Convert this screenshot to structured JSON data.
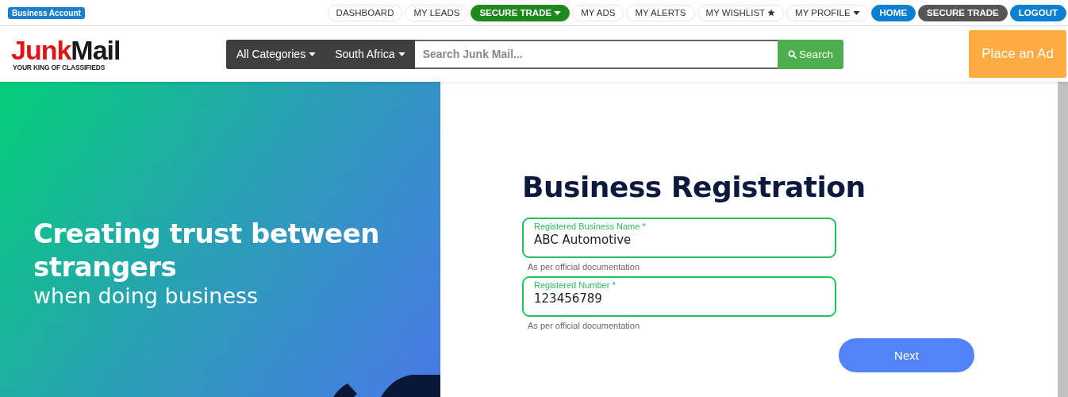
{
  "account_badge": "Business Account",
  "top_nav": [
    {
      "label": "DASHBOARD",
      "kind": "pill"
    },
    {
      "label": "MY LEADS",
      "kind": "pill"
    },
    {
      "label": "SECURE TRADE",
      "kind": "green-caret"
    },
    {
      "label": "MY ADS",
      "kind": "pill"
    },
    {
      "label": "MY ALERTS",
      "kind": "pill"
    },
    {
      "label": "MY WISHLIST",
      "kind": "pill-star"
    },
    {
      "label": "MY PROFILE",
      "kind": "pill-caret"
    },
    {
      "label": "HOME",
      "kind": "blue"
    },
    {
      "label": "SECURE TRADE",
      "kind": "dark"
    },
    {
      "label": "LOGOUT",
      "kind": "blue"
    }
  ],
  "logo": {
    "word_1": "Junk",
    "word_2": "Mail",
    "tagline": "YOUR KING OF CLASSIFIEDS"
  },
  "search": {
    "category": "All Categories",
    "region": "South Africa",
    "placeholder": "Search Junk Mail...",
    "button": "Search"
  },
  "place_ad": "Place an Ad",
  "hero": {
    "headline": "Creating trust between strangers",
    "subline": "when doing business"
  },
  "form": {
    "title": "Business Registration",
    "fields": [
      {
        "label": "Registered Business Name *",
        "value": "ABC Automotive",
        "hint": "As per official documentation"
      },
      {
        "label": "Registered Number *",
        "value": "123456789",
        "hint": "As per official documentation"
      }
    ],
    "next": "Next"
  }
}
